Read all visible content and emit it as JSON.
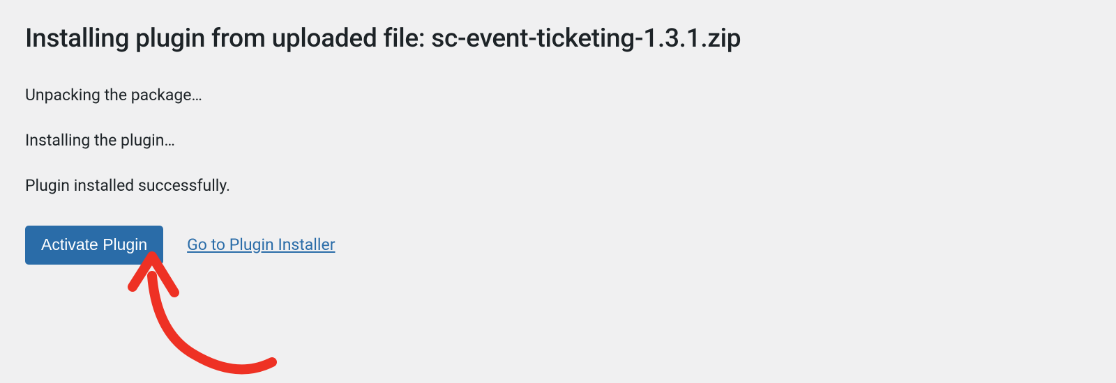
{
  "header": {
    "title": "Installing plugin from uploaded file: sc-event-ticketing-1.3.1.zip"
  },
  "status": {
    "line1": "Unpacking the package…",
    "line2": "Installing the plugin…",
    "line3": "Plugin installed successfully."
  },
  "actions": {
    "activate_label": "Activate Plugin",
    "installer_link_label": "Go to Plugin Installer"
  },
  "colors": {
    "background": "#f0f0f1",
    "text": "#1d2327",
    "primary": "#2a6ca8",
    "annotation": "#ee3124"
  }
}
